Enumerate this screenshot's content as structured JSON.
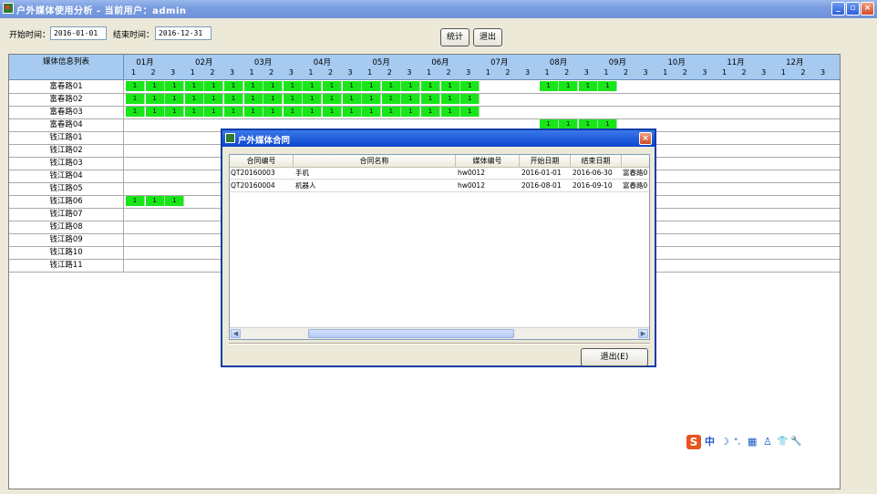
{
  "window": {
    "title": "户外媒体使用分析 - 当前用户：admin",
    "controls": [
      "_",
      "▫",
      "×"
    ]
  },
  "toolbar": {
    "start_label": "开始时间：",
    "start_value": "2016-01-01",
    "end_label": "结束时间：",
    "end_value": "2016-12-31",
    "stats_button": "统计",
    "exit_button": "退出"
  },
  "grid": {
    "corner_label": "媒体信息列表",
    "months": [
      "01月",
      "02月",
      "03月",
      "04月",
      "05月",
      "06月",
      "07月",
      "08月",
      "09月",
      "10月",
      "11月",
      "12月"
    ],
    "periods": [
      "1",
      "2",
      "3"
    ],
    "rows": [
      {
        "name": "富春路01",
        "occupied": [
          0,
          1,
          2,
          3,
          4,
          5,
          6,
          7,
          8,
          9,
          10,
          11,
          12,
          13,
          14,
          15,
          16,
          17,
          21,
          22,
          23,
          24
        ]
      },
      {
        "name": "富春路02",
        "occupied": [
          0,
          1,
          2,
          3,
          4,
          5,
          6,
          7,
          8,
          9,
          10,
          11,
          12,
          13,
          14,
          15,
          16,
          17
        ]
      },
      {
        "name": "富春路03",
        "occupied": [
          0,
          1,
          2,
          3,
          4,
          5,
          6,
          7,
          8,
          9,
          10,
          11,
          12,
          13,
          14,
          15,
          16,
          17
        ]
      },
      {
        "name": "富春路04",
        "occupied": [
          21,
          22,
          23,
          24
        ]
      },
      {
        "name": "钱江路01",
        "occupied": []
      },
      {
        "name": "钱江路02",
        "occupied": []
      },
      {
        "name": "钱江路03",
        "occupied": []
      },
      {
        "name": "钱江路04",
        "occupied": []
      },
      {
        "name": "钱江路05",
        "occupied": []
      },
      {
        "name": "钱江路06",
        "occupied": [
          0,
          1,
          2
        ]
      },
      {
        "name": "钱江路07",
        "occupied": []
      },
      {
        "name": "钱江路08",
        "occupied": []
      },
      {
        "name": "钱江路09",
        "occupied": []
      },
      {
        "name": "钱江路10",
        "occupied": []
      },
      {
        "name": "钱江路11",
        "occupied": []
      }
    ],
    "cell_mark": "1",
    "occupied_color": "#19e619",
    "header_color": "#a6caf0"
  },
  "dialog": {
    "title": "户外媒体合同",
    "close": "×",
    "columns": [
      "合同编号",
      "合同名称",
      "媒体编号",
      "开始日期",
      "结束日期"
    ],
    "rows": [
      {
        "id": "QT20160003",
        "name": "手机",
        "media": "hw0012",
        "start": "2016-01-01",
        "end": "2016-06-30",
        "extra": "富春路0"
      },
      {
        "id": "QT20160004",
        "name": "机器人",
        "media": "hw0012",
        "start": "2016-08-01",
        "end": "2016-09-10",
        "extra": "富春路0"
      }
    ],
    "exit_button": "退出(E)"
  },
  "ime": {
    "logo": "S",
    "items": [
      "中",
      "☽",
      "°,",
      "▦",
      "♙",
      "👕",
      "🔧"
    ]
  }
}
